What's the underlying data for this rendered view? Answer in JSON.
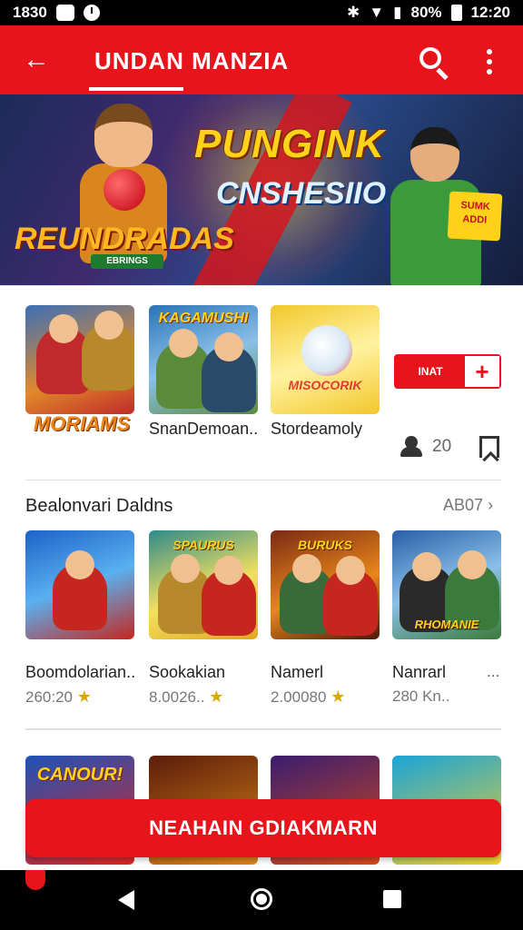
{
  "status_bar": {
    "time_left": "1830",
    "battery": "80%",
    "time_right": "12:20"
  },
  "app_bar": {
    "title": "UNDAN MANZIA"
  },
  "banner": {
    "title": "PUNGINK",
    "subtitle": "CNSHESIIO",
    "logo": "REUNDRADAS",
    "sublogo": "EBRINGS",
    "badge": "SUMK ADDI"
  },
  "featured": {
    "items": [
      {
        "art_label": "MORIAMS",
        "caption": "",
        "colors": [
          "#3b6fb8",
          "#c02a2a"
        ]
      },
      {
        "art_label": "KAGAMUSHI",
        "caption": "SnanDemoan..",
        "colors": [
          "#2a73b8",
          "#5a8a3a"
        ]
      },
      {
        "art_label": "MISOCORIK",
        "caption": "Stordeamoly",
        "colors": [
          "#f2c72a",
          "#e23a3a"
        ]
      }
    ],
    "add_label": "INAT",
    "players_count": "20"
  },
  "section2": {
    "title": "Bealonvari Daldns",
    "more_label": "AB07",
    "items": [
      {
        "art_label": "",
        "caption": "Boomdolarian..",
        "meta": "260:20",
        "colors": [
          "#1d62c9",
          "#c5261f"
        ]
      },
      {
        "art_label": "SPAURUS",
        "caption": "Sookakian",
        "meta": "8.0026..",
        "colors": [
          "#2f8a8a",
          "#e0a81f"
        ]
      },
      {
        "art_label": "BURUKS",
        "caption": "Namerl",
        "meta": "2.00080",
        "colors": [
          "#7a2a14",
          "#e8861a"
        ]
      },
      {
        "art_label": "RHOMANIE",
        "caption": "Nanrarl",
        "meta": "280 Kn..",
        "colors": [
          "#2a5ea8",
          "#3a7a3a"
        ]
      }
    ]
  },
  "section3": {
    "items": [
      {
        "art_label": "CANOUR!",
        "colors": [
          "#1d52b8",
          "#e0261f"
        ]
      },
      {
        "art_label": "",
        "colors": [
          "#5a1d0a",
          "#e0861a"
        ]
      },
      {
        "art_label": "",
        "colors": [
          "#3a1d6e",
          "#d84a1a"
        ]
      },
      {
        "art_label": "",
        "colors": [
          "#1aa4d8",
          "#f2d02a"
        ]
      }
    ]
  },
  "cta_label": "NEAHAIN GDIAKMARN",
  "accent_color": "#e8141c"
}
